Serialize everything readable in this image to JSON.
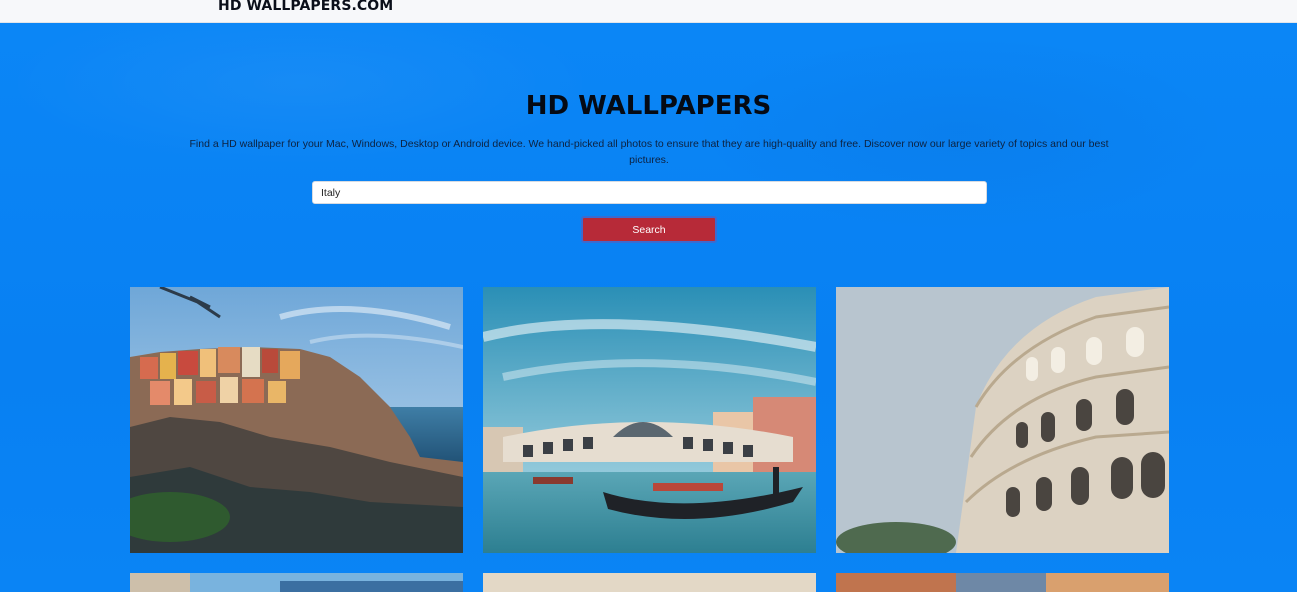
{
  "header": {
    "brand": "HD WALLPAPERS.COM"
  },
  "hero": {
    "title": "HD WALLPAPERS",
    "description": "Find a HD wallpaper for your Mac, Windows, Desktop or Android device. We hand-picked all photos to ensure that they are high-quality and free. Discover now our large variety of topics and our best pictures."
  },
  "search": {
    "value": "Italy",
    "button_label": "Search"
  },
  "gallery": {
    "images": [
      {
        "subject": "cinque-terre-coastal-village"
      },
      {
        "subject": "venice-rialto-bridge-gondola"
      },
      {
        "subject": "rome-colosseum"
      },
      {
        "subject": "coastal-town-harbor"
      },
      {
        "subject": "beige-architecture"
      },
      {
        "subject": "narrow-street-buildings"
      }
    ]
  },
  "colors": {
    "hero_bg": "#0a84f5",
    "button_bg": "#b72a38",
    "header_bg": "#f7f8fa"
  }
}
